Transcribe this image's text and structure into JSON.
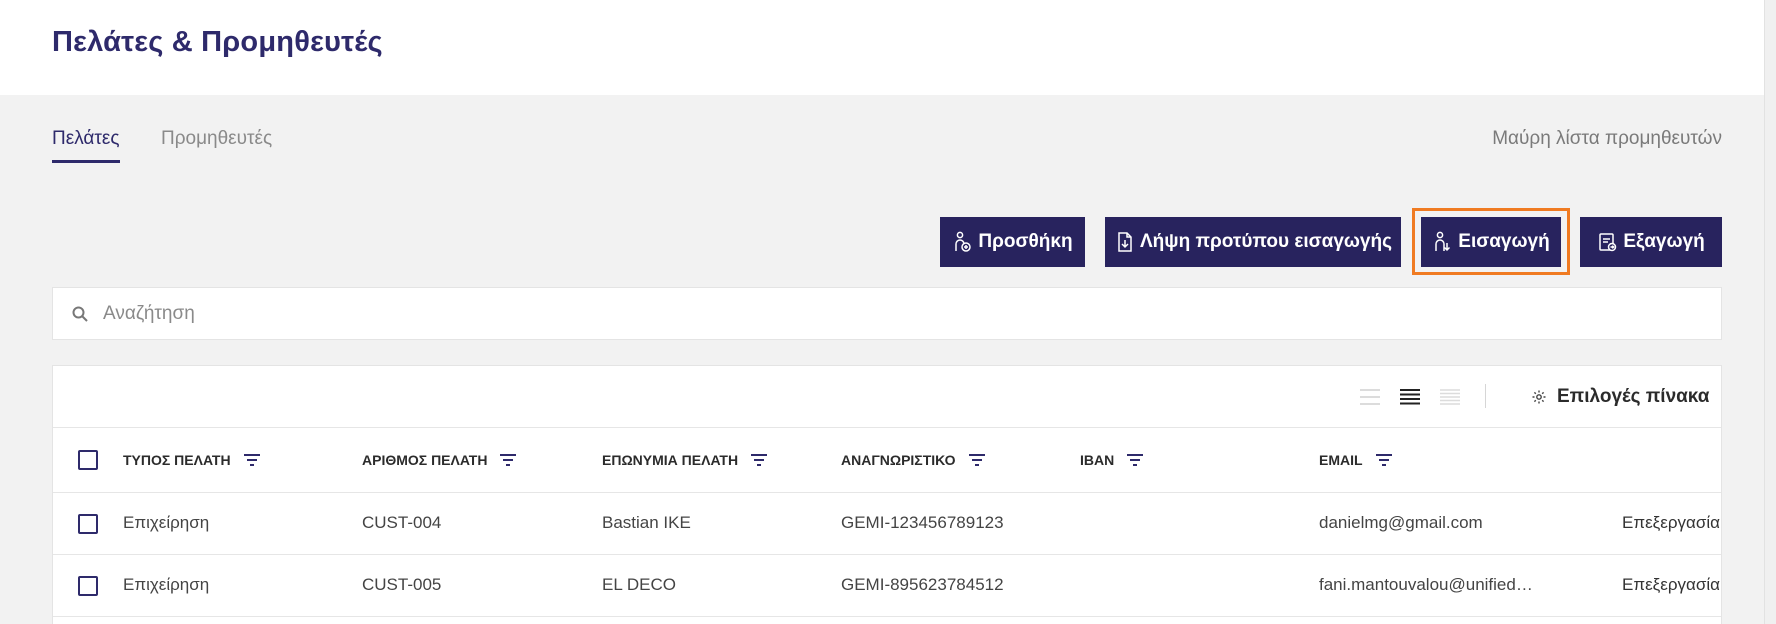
{
  "header": {
    "title": "Πελάτες & Προμηθευτές"
  },
  "tabs": [
    {
      "label": "Πελάτες",
      "active": true
    },
    {
      "label": "Προμηθευτές",
      "active": false
    }
  ],
  "blacklist_link": "Μαύρη λίστα προμηθευτών",
  "actions": {
    "add": "Προσθήκη",
    "template": "Λήψη προτύπου εισαγωγής",
    "import": "Εισαγωγή",
    "export": "Εξαγωγή"
  },
  "search": {
    "placeholder": "Αναζήτηση",
    "value": ""
  },
  "table": {
    "options_label": "Επιλογές πίνακα",
    "columns": [
      "ΤΥΠΟΣ ΠΕΛΑΤΗ",
      "ΑΡΙΘΜΟΣ ΠΕΛΑΤΗ",
      "ΕΠΩΝΥΜΙΑ ΠΕΛΑΤΗ",
      "ΑΝΑΓΝΩΡΙΣΤΙΚΟ",
      "IBAN",
      "EMAIL"
    ],
    "rows": [
      {
        "type": "Επιχείρηση",
        "number": "CUST-004",
        "name": "Bastian IKE",
        "identifier": "GEMI-123456789123",
        "iban": "",
        "email": "danielmg@gmail.com",
        "action": "Επεξεργασία"
      },
      {
        "type": "Επιχείρηση",
        "number": "CUST-005",
        "name": "EL DECO",
        "identifier": "GEMI-895623784512",
        "iban": "",
        "email": "fani.mantouvalou@unified…",
        "action": "Επεξεργασία"
      }
    ]
  },
  "colors": {
    "primary": "#28235e",
    "title": "#2e2a6b",
    "highlight": "#f07b22",
    "background": "#f2f2f2"
  }
}
